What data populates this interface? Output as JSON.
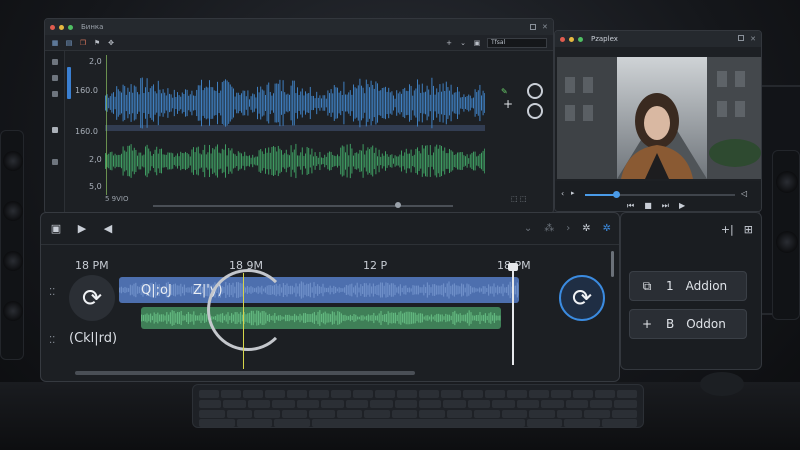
{
  "editor": {
    "title": "Бинка",
    "field_value": "Tfsal",
    "ruler": [
      "2,0",
      "160.0",
      "160.0",
      "2,0",
      "5,0"
    ],
    "status": "5 9VIO"
  },
  "preview": {
    "title": "Pzaplex"
  },
  "timeline": {
    "times": [
      "18 PM",
      "18 9M",
      "12 P",
      "18 PM"
    ],
    "clip_text_1": "Q|;oJ",
    "clip_text_2": "Z|'y)",
    "caption": "(Ckl|rd)"
  },
  "sidepanel": {
    "button1": {
      "number": "1",
      "label": "Addion"
    },
    "button2": {
      "number": "B",
      "label": "Oddon"
    }
  },
  "colors": {
    "accent": "#3b8be0",
    "wave_blue": "#3f7fc0",
    "wave_green": "#3f9c62",
    "playhead_green": "#9fdc6a"
  }
}
